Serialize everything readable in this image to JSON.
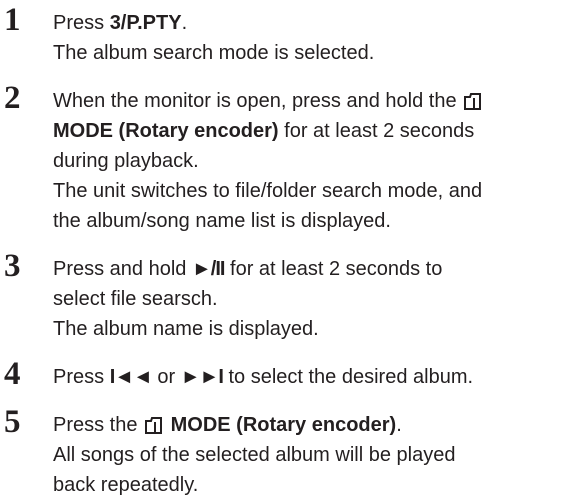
{
  "steps": [
    {
      "number": "1",
      "press": "Press ",
      "key": "3/P.PTY",
      "key_end": ".",
      "result": "The album search mode is selected."
    },
    {
      "number": "2",
      "line1": "When the monitor is open, press and hold the",
      "mode_label": "MODE (Rotary encoder)",
      "line2_rest": " for at least 2 seconds",
      "line3": "during playback.",
      "line4": "The unit switches to file/folder search mode, and",
      "line5": "the album/song name list is displayed."
    },
    {
      "number": "3",
      "press": "Press and hold ",
      "key": "►/II",
      "line1_rest": " for at least 2 seconds to",
      "line2": "select file searsch.",
      "line3": "The album name is displayed."
    },
    {
      "number": "4",
      "press": "Press ",
      "key_prev": "I◄◄",
      "or": " or ",
      "key_next": "►►I",
      "rest": " to select the desired album."
    },
    {
      "number": "5",
      "press": "Press the ",
      "mode_label": "MODE (Rotary encoder)",
      "end": ".",
      "line2": "All songs of the selected album will be played",
      "line3": "back repeatedly."
    }
  ],
  "icons": {
    "mode_button": "mode-button-icon",
    "play_pause": "play-pause-icon",
    "skip_previous": "skip-previous-icon",
    "skip_next": "skip-next-icon"
  }
}
